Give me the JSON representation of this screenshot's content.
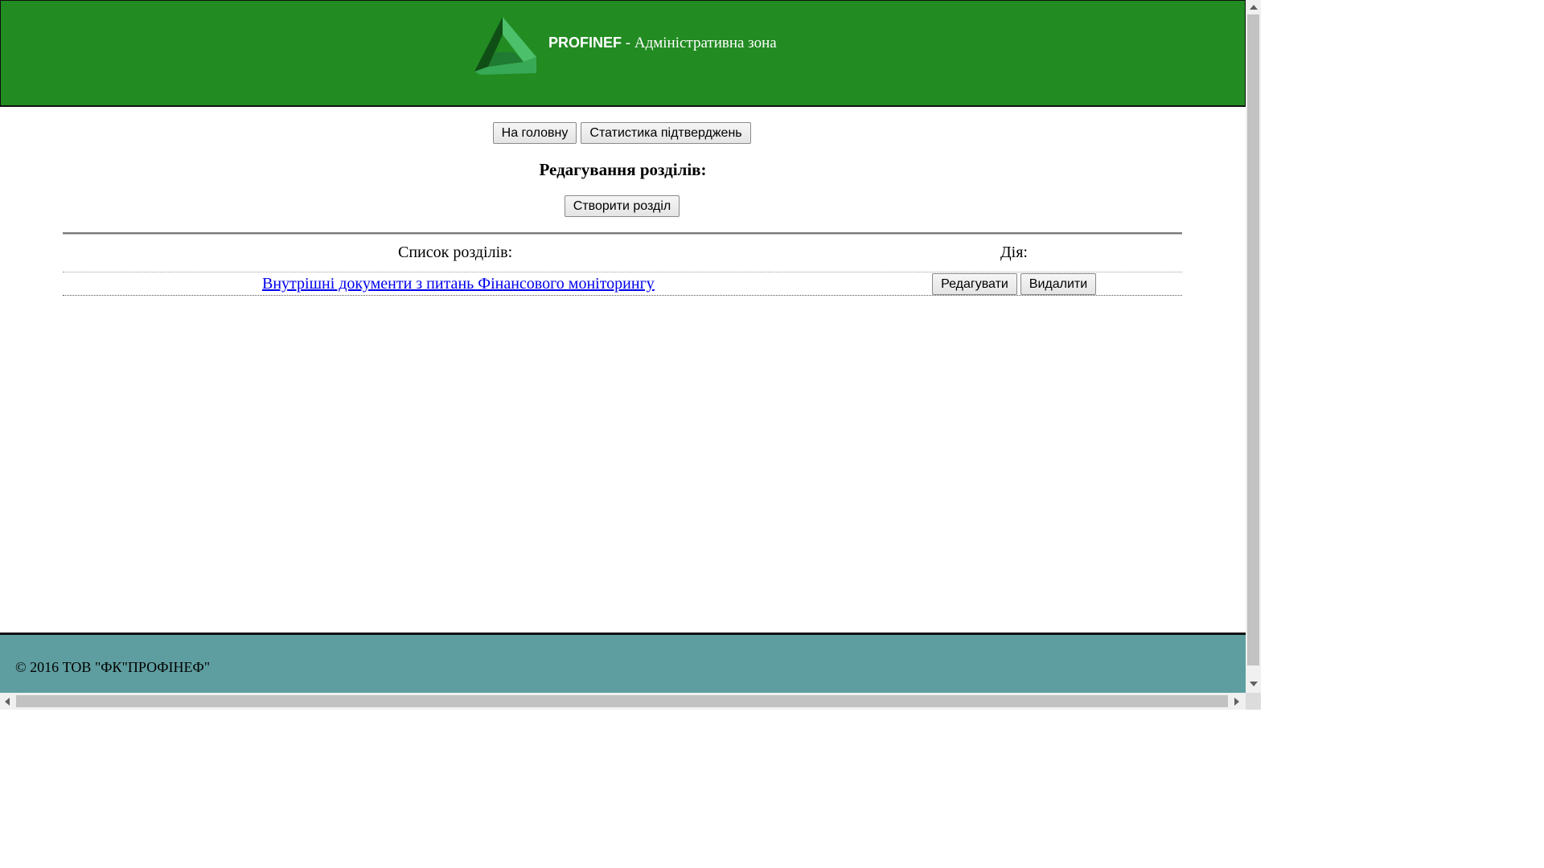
{
  "header": {
    "brand": "PROFINEF",
    "subtitle": " - Адміністративна зона",
    "logo_icon": "triangle-logo-icon",
    "bg_color": "#228b22"
  },
  "nav": {
    "home_label": "На головну",
    "stats_label": "Статистика підтверджень"
  },
  "main": {
    "title": "Редагування розділів:",
    "create_label": "Створити розділ"
  },
  "table": {
    "col_list": "Список розділів:",
    "col_action": "Дія:",
    "rows": [
      {
        "name": "Внутрішні документи з питань Фінансового моніторингу",
        "edit_label": "Редагувати",
        "delete_label": "Видалити"
      }
    ]
  },
  "footer": {
    "copyright": "© 2016 ТОВ \"ФК\"ПРОФІНЕФ\"",
    "bg_color": "#5f9ea0"
  }
}
